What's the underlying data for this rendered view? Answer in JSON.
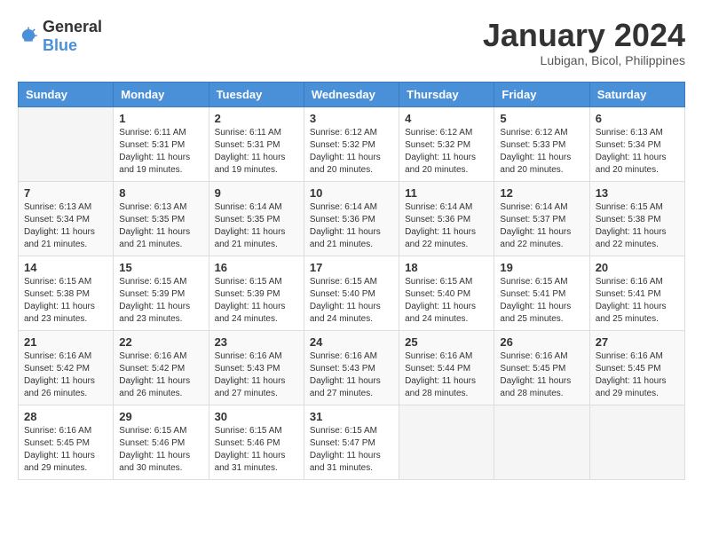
{
  "logo": {
    "general": "General",
    "blue": "Blue"
  },
  "title": "January 2024",
  "location": "Lubigan, Bicol, Philippines",
  "weekdays": [
    "Sunday",
    "Monday",
    "Tuesday",
    "Wednesday",
    "Thursday",
    "Friday",
    "Saturday"
  ],
  "weeks": [
    [
      {
        "day": "",
        "sunrise": "",
        "sunset": "",
        "daylight": ""
      },
      {
        "day": "1",
        "sunrise": "Sunrise: 6:11 AM",
        "sunset": "Sunset: 5:31 PM",
        "daylight": "Daylight: 11 hours and 19 minutes."
      },
      {
        "day": "2",
        "sunrise": "Sunrise: 6:11 AM",
        "sunset": "Sunset: 5:31 PM",
        "daylight": "Daylight: 11 hours and 19 minutes."
      },
      {
        "day": "3",
        "sunrise": "Sunrise: 6:12 AM",
        "sunset": "Sunset: 5:32 PM",
        "daylight": "Daylight: 11 hours and 20 minutes."
      },
      {
        "day": "4",
        "sunrise": "Sunrise: 6:12 AM",
        "sunset": "Sunset: 5:32 PM",
        "daylight": "Daylight: 11 hours and 20 minutes."
      },
      {
        "day": "5",
        "sunrise": "Sunrise: 6:12 AM",
        "sunset": "Sunset: 5:33 PM",
        "daylight": "Daylight: 11 hours and 20 minutes."
      },
      {
        "day": "6",
        "sunrise": "Sunrise: 6:13 AM",
        "sunset": "Sunset: 5:34 PM",
        "daylight": "Daylight: 11 hours and 20 minutes."
      }
    ],
    [
      {
        "day": "7",
        "sunrise": "Sunrise: 6:13 AM",
        "sunset": "Sunset: 5:34 PM",
        "daylight": "Daylight: 11 hours and 21 minutes."
      },
      {
        "day": "8",
        "sunrise": "Sunrise: 6:13 AM",
        "sunset": "Sunset: 5:35 PM",
        "daylight": "Daylight: 11 hours and 21 minutes."
      },
      {
        "day": "9",
        "sunrise": "Sunrise: 6:14 AM",
        "sunset": "Sunset: 5:35 PM",
        "daylight": "Daylight: 11 hours and 21 minutes."
      },
      {
        "day": "10",
        "sunrise": "Sunrise: 6:14 AM",
        "sunset": "Sunset: 5:36 PM",
        "daylight": "Daylight: 11 hours and 21 minutes."
      },
      {
        "day": "11",
        "sunrise": "Sunrise: 6:14 AM",
        "sunset": "Sunset: 5:36 PM",
        "daylight": "Daylight: 11 hours and 22 minutes."
      },
      {
        "day": "12",
        "sunrise": "Sunrise: 6:14 AM",
        "sunset": "Sunset: 5:37 PM",
        "daylight": "Daylight: 11 hours and 22 minutes."
      },
      {
        "day": "13",
        "sunrise": "Sunrise: 6:15 AM",
        "sunset": "Sunset: 5:38 PM",
        "daylight": "Daylight: 11 hours and 22 minutes."
      }
    ],
    [
      {
        "day": "14",
        "sunrise": "Sunrise: 6:15 AM",
        "sunset": "Sunset: 5:38 PM",
        "daylight": "Daylight: 11 hours and 23 minutes."
      },
      {
        "day": "15",
        "sunrise": "Sunrise: 6:15 AM",
        "sunset": "Sunset: 5:39 PM",
        "daylight": "Daylight: 11 hours and 23 minutes."
      },
      {
        "day": "16",
        "sunrise": "Sunrise: 6:15 AM",
        "sunset": "Sunset: 5:39 PM",
        "daylight": "Daylight: 11 hours and 24 minutes."
      },
      {
        "day": "17",
        "sunrise": "Sunrise: 6:15 AM",
        "sunset": "Sunset: 5:40 PM",
        "daylight": "Daylight: 11 hours and 24 minutes."
      },
      {
        "day": "18",
        "sunrise": "Sunrise: 6:15 AM",
        "sunset": "Sunset: 5:40 PM",
        "daylight": "Daylight: 11 hours and 24 minutes."
      },
      {
        "day": "19",
        "sunrise": "Sunrise: 6:15 AM",
        "sunset": "Sunset: 5:41 PM",
        "daylight": "Daylight: 11 hours and 25 minutes."
      },
      {
        "day": "20",
        "sunrise": "Sunrise: 6:16 AM",
        "sunset": "Sunset: 5:41 PM",
        "daylight": "Daylight: 11 hours and 25 minutes."
      }
    ],
    [
      {
        "day": "21",
        "sunrise": "Sunrise: 6:16 AM",
        "sunset": "Sunset: 5:42 PM",
        "daylight": "Daylight: 11 hours and 26 minutes."
      },
      {
        "day": "22",
        "sunrise": "Sunrise: 6:16 AM",
        "sunset": "Sunset: 5:42 PM",
        "daylight": "Daylight: 11 hours and 26 minutes."
      },
      {
        "day": "23",
        "sunrise": "Sunrise: 6:16 AM",
        "sunset": "Sunset: 5:43 PM",
        "daylight": "Daylight: 11 hours and 27 minutes."
      },
      {
        "day": "24",
        "sunrise": "Sunrise: 6:16 AM",
        "sunset": "Sunset: 5:43 PM",
        "daylight": "Daylight: 11 hours and 27 minutes."
      },
      {
        "day": "25",
        "sunrise": "Sunrise: 6:16 AM",
        "sunset": "Sunset: 5:44 PM",
        "daylight": "Daylight: 11 hours and 28 minutes."
      },
      {
        "day": "26",
        "sunrise": "Sunrise: 6:16 AM",
        "sunset": "Sunset: 5:45 PM",
        "daylight": "Daylight: 11 hours and 28 minutes."
      },
      {
        "day": "27",
        "sunrise": "Sunrise: 6:16 AM",
        "sunset": "Sunset: 5:45 PM",
        "daylight": "Daylight: 11 hours and 29 minutes."
      }
    ],
    [
      {
        "day": "28",
        "sunrise": "Sunrise: 6:16 AM",
        "sunset": "Sunset: 5:45 PM",
        "daylight": "Daylight: 11 hours and 29 minutes."
      },
      {
        "day": "29",
        "sunrise": "Sunrise: 6:15 AM",
        "sunset": "Sunset: 5:46 PM",
        "daylight": "Daylight: 11 hours and 30 minutes."
      },
      {
        "day": "30",
        "sunrise": "Sunrise: 6:15 AM",
        "sunset": "Sunset: 5:46 PM",
        "daylight": "Daylight: 11 hours and 31 minutes."
      },
      {
        "day": "31",
        "sunrise": "Sunrise: 6:15 AM",
        "sunset": "Sunset: 5:47 PM",
        "daylight": "Daylight: 11 hours and 31 minutes."
      },
      {
        "day": "",
        "sunrise": "",
        "sunset": "",
        "daylight": ""
      },
      {
        "day": "",
        "sunrise": "",
        "sunset": "",
        "daylight": ""
      },
      {
        "day": "",
        "sunrise": "",
        "sunset": "",
        "daylight": ""
      }
    ]
  ]
}
